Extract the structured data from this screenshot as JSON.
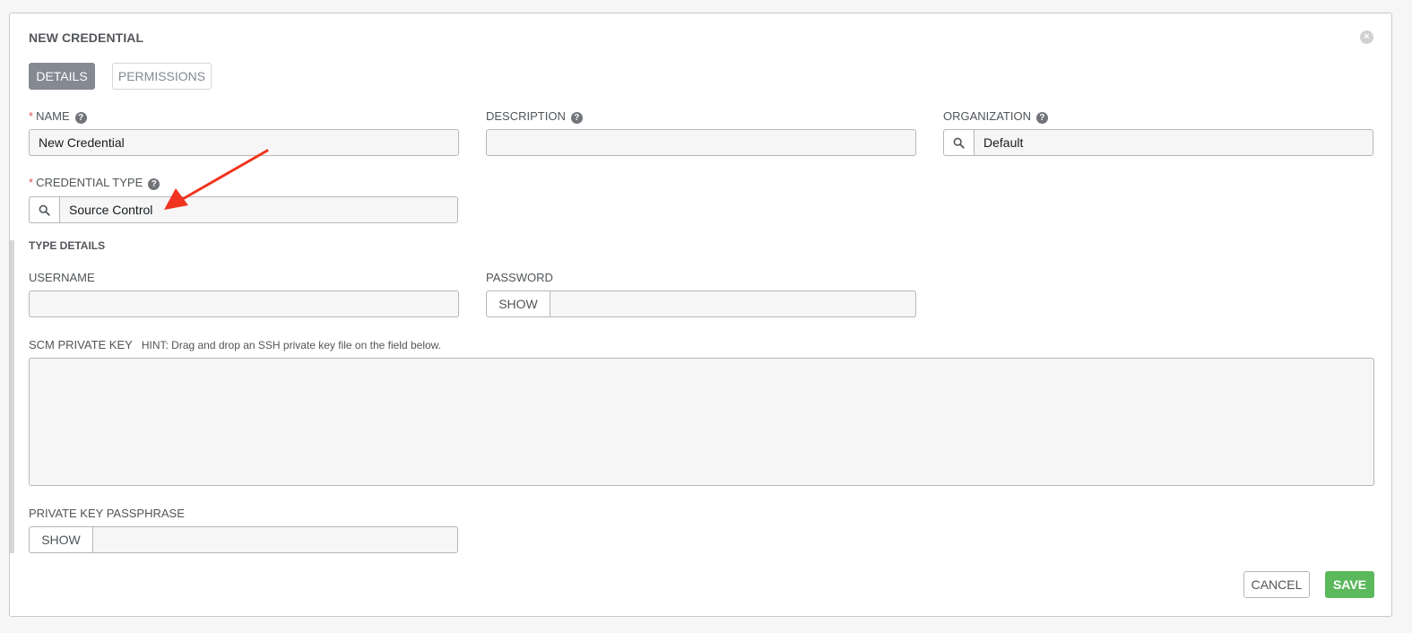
{
  "dialog": {
    "title": "NEW CREDENTIAL",
    "close_icon": "close-icon"
  },
  "tabs": [
    {
      "label": "DETAILS",
      "active": true
    },
    {
      "label": "PERMISSIONS",
      "active": false
    }
  ],
  "fields": {
    "name": {
      "label": "NAME",
      "required": "*",
      "value": "New Credential"
    },
    "description": {
      "label": "DESCRIPTION",
      "value": ""
    },
    "organization": {
      "label": "ORGANIZATION",
      "value": "Default"
    },
    "credential_type": {
      "label": "CREDENTIAL TYPE",
      "required": "*",
      "value": "Source Control"
    }
  },
  "type_details": {
    "heading": "TYPE DETAILS",
    "username": {
      "label": "USERNAME",
      "value": ""
    },
    "password": {
      "label": "PASSWORD",
      "show_label": "SHOW",
      "value": ""
    },
    "scm_private_key": {
      "label": "SCM PRIVATE KEY",
      "hint": "HINT: Drag and drop an SSH private key file on the field below."
    },
    "private_key_passphrase": {
      "label": "PRIVATE KEY PASSPHRASE",
      "show_label": "SHOW"
    }
  },
  "help_glyph": "?",
  "actions": {
    "cancel": "CANCEL",
    "save": "SAVE"
  },
  "colors": {
    "save": "#5cb85c",
    "active_tab": "#848992",
    "required": "#d9534f",
    "annotation_arrow": "#f0341f"
  }
}
